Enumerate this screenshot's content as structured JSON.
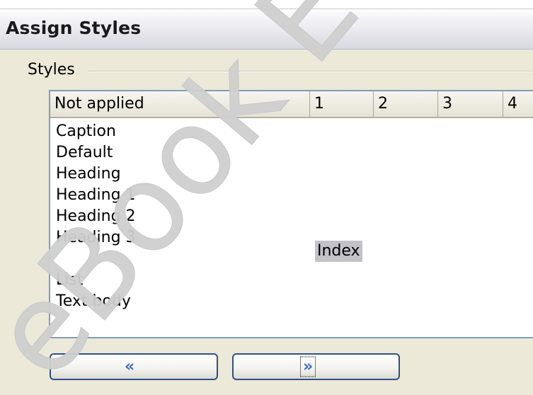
{
  "window": {
    "title": "Assign Styles"
  },
  "group": {
    "label": "Styles"
  },
  "table": {
    "columns": [
      "Not applied",
      "1",
      "2",
      "3",
      "4"
    ],
    "rows": [
      "Caption",
      "Default",
      "Heading",
      "Heading 1",
      "Heading 2",
      "Heading 3",
      "",
      "List",
      "Text body"
    ],
    "highlighted_cell": "Index"
  },
  "buttons": {
    "prev": "«",
    "next": "»"
  },
  "watermark": {
    "text": "eBook E"
  },
  "colors": {
    "panel": "#ece9d8",
    "border": "#7f9db9",
    "button_border": "#2e4f8c",
    "arrow": "#3d6ac9",
    "highlight": "#c2c2c8"
  }
}
